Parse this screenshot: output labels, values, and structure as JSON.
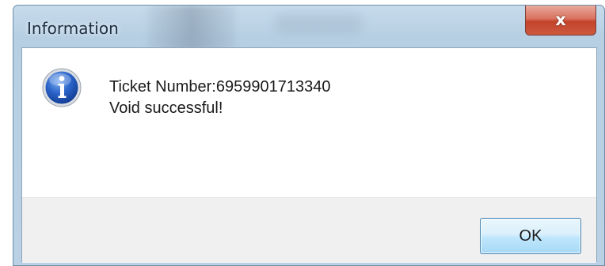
{
  "window": {
    "title": "Information"
  },
  "message": {
    "line1": "Ticket Number:6959901713340",
    "line2": "Void successful!"
  },
  "buttons": {
    "ok_label": "OK",
    "close_glyph": "x"
  },
  "icons": {
    "message_icon": "information-icon",
    "close_icon": "close-icon"
  },
  "colors": {
    "close_button_red": "#c2432a",
    "ok_button_border": "#3c7fb1",
    "info_icon_blue": "#1f55b5"
  }
}
